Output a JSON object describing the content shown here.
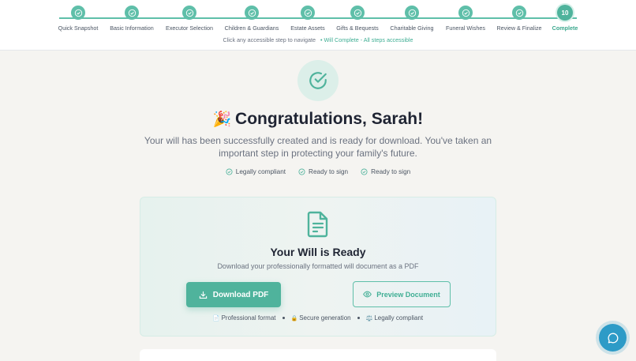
{
  "stepper": {
    "steps": [
      {
        "label": "Quick Snapshot"
      },
      {
        "label": "Basic Information"
      },
      {
        "label": "Executor Selection"
      },
      {
        "label": "Children & Guardians"
      },
      {
        "label": "Estate Assets"
      },
      {
        "label": "Gifts & Bequests"
      },
      {
        "label": "Charitable Giving"
      },
      {
        "label": "Funeral Wishes"
      },
      {
        "label": "Review & Finalize"
      },
      {
        "label": "Complete",
        "number": "10"
      }
    ],
    "hint": "Click any accessible step to navigate",
    "status": "• Will Complete - All steps accessible"
  },
  "hero": {
    "emoji": "🎉",
    "title": "Congratulations, Sarah!",
    "subtitle": "Your will has been successfully created and is ready for download. You've taken an important step in protecting your family's future.",
    "features": [
      "Legally compliant",
      "Ready to sign",
      "Ready to sign"
    ]
  },
  "card": {
    "title": "Your Will is Ready",
    "subtitle": "Download your professionally formatted will document as a PDF",
    "download_label": "Download PDF",
    "preview_label": "Preview Document",
    "meta": [
      {
        "icon": "📄",
        "text": "Professional format"
      },
      {
        "icon": "🔒",
        "text": "Secure generation"
      },
      {
        "icon": "⚖️",
        "text": "Legally compliant"
      }
    ]
  },
  "colors": {
    "accent": "#4fb39c",
    "accent_light": "#dcefe9",
    "chat": "#2d9bc7",
    "background": "#f5f4f1"
  },
  "icons": [
    "check-circle-icon",
    "document-icon",
    "download-icon",
    "eye-icon",
    "chat-icon"
  ]
}
